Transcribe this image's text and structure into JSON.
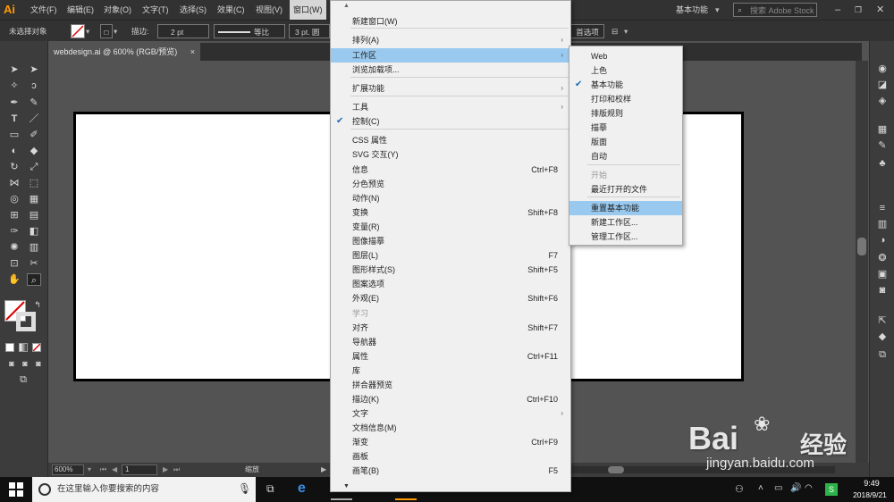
{
  "menubar": {
    "logo": "Ai",
    "items": [
      "文件(F)",
      "编辑(E)",
      "对象(O)",
      "文字(T)",
      "选择(S)",
      "效果(C)",
      "视图(V)",
      "窗口(W)"
    ],
    "workspace": "基本功能",
    "search_placeholder": "搜索 Adobe Stock"
  },
  "controlbar": {
    "no_selection": "未选择对象",
    "stroke_label": "描边:",
    "stroke_value": "2 pt",
    "stroke_style": "等比",
    "stroke_round": "3 pt. 圆",
    "tail_label": "首选项"
  },
  "document": {
    "tab_title": "webdesign.ai @ 600% (RGB/预览)",
    "close": "×"
  },
  "statusbar": {
    "zoom": "600%",
    "page": "1",
    "mode": "缩放"
  },
  "window_menu": {
    "up_arrow": "▲",
    "down_arrow": "▼",
    "items": [
      {
        "label": "新建窗口(W)"
      },
      {
        "label": "排列(A)",
        "arrow": "›"
      },
      {
        "label": "工作区",
        "arrow": "›",
        "highlighted": true
      },
      {
        "label": "浏览加载项..."
      },
      {
        "label": "扩展功能",
        "arrow": "›"
      },
      {
        "label": "工具",
        "arrow": "›"
      },
      {
        "label": "控制(C)",
        "check": "✔"
      },
      {
        "label": "CSS 属性"
      },
      {
        "label": "SVG 交互(Y)"
      },
      {
        "label": "信息",
        "shortcut": "Ctrl+F8"
      },
      {
        "label": "分色预览"
      },
      {
        "label": "动作(N)"
      },
      {
        "label": "变换",
        "shortcut": "Shift+F8"
      },
      {
        "label": "变量(R)"
      },
      {
        "label": "图像描摹"
      },
      {
        "label": "图层(L)",
        "shortcut": "F7"
      },
      {
        "label": "图形样式(S)",
        "shortcut": "Shift+F5"
      },
      {
        "label": "图案选项"
      },
      {
        "label": "外观(E)",
        "shortcut": "Shift+F6"
      },
      {
        "label": "学习",
        "disabled": true
      },
      {
        "label": "对齐",
        "shortcut": "Shift+F7"
      },
      {
        "label": "导航器"
      },
      {
        "label": "属性",
        "shortcut": "Ctrl+F11"
      },
      {
        "label": "库"
      },
      {
        "label": "拼合器预览"
      },
      {
        "label": "描边(K)",
        "shortcut": "Ctrl+F10"
      },
      {
        "label": "文字",
        "arrow": "›"
      },
      {
        "label": "文档信息(M)"
      },
      {
        "label": "渐变",
        "shortcut": "Ctrl+F9"
      },
      {
        "label": "画板"
      },
      {
        "label": "画笔(B)",
        "shortcut": "F5"
      }
    ]
  },
  "workspace_submenu": {
    "items": [
      {
        "label": "Web"
      },
      {
        "label": "上色"
      },
      {
        "label": "基本功能",
        "check": "✔"
      },
      {
        "label": "打印和校样"
      },
      {
        "label": "排版规则"
      },
      {
        "label": "描摹"
      },
      {
        "label": "版面"
      },
      {
        "label": "自动"
      },
      {
        "label": "开始",
        "disabled": true
      },
      {
        "label": "最近打开的文件"
      },
      {
        "label": "重置基本功能",
        "highlighted": true
      },
      {
        "label": "新建工作区..."
      },
      {
        "label": "管理工作区..."
      }
    ]
  },
  "taskbar": {
    "search_placeholder": "在这里输入你要搜索的内容",
    "time": "9:49",
    "date": "2018/9/21"
  },
  "watermark": {
    "brand": "Bai",
    "brand_cn": "经验",
    "url": "jingyan.baidu.com"
  }
}
